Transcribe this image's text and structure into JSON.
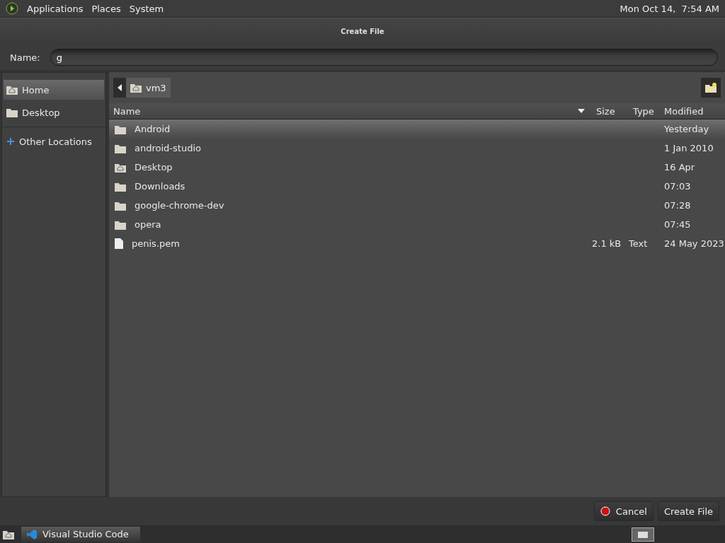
{
  "top_panel": {
    "menus": [
      "Applications",
      "Places",
      "System"
    ],
    "clock": "Mon Oct 14,  7:54 AM"
  },
  "window": {
    "title": "Create File"
  },
  "name_field": {
    "label": "Name:",
    "value": "g"
  },
  "sidebar": {
    "items": [
      {
        "label": "Home",
        "kind": "home",
        "selected": true
      },
      {
        "label": "Desktop",
        "kind": "folder",
        "selected": false
      },
      {
        "label": "Other Locations",
        "kind": "plus",
        "selected": false
      }
    ]
  },
  "path_bar": {
    "segments": [
      {
        "label": "vm3",
        "selected": true
      }
    ]
  },
  "table": {
    "columns": [
      "Name",
      "Size",
      "Type",
      "Modified"
    ],
    "rows": [
      {
        "name": "Android",
        "kind": "folder",
        "size": "",
        "type": "",
        "modified": "Yesterday",
        "selected": true
      },
      {
        "name": "android-studio",
        "kind": "folder",
        "modified": "1 Jan 2010",
        "selected": false
      },
      {
        "name": "Desktop",
        "kind": "home",
        "modified": "16 Apr",
        "selected": false
      },
      {
        "name": "Downloads",
        "kind": "folder",
        "modified": "07:03",
        "selected": false
      },
      {
        "name": "google-chrome-dev",
        "kind": "folder",
        "modified": "07:28",
        "selected": false
      },
      {
        "name": "opera",
        "kind": "folder",
        "modified": "07:45",
        "selected": false
      },
      {
        "name": "penis.pem",
        "kind": "file",
        "size": "2.1 kB",
        "type": "Text",
        "modified": "24 May 2023",
        "selected": false
      }
    ]
  },
  "buttons": [
    {
      "label": "Cancel",
      "kind": "cancel"
    },
    {
      "label": "Create File",
      "kind": "default"
    }
  ],
  "taskbar": {
    "tasks": [
      {
        "label": "Visual Studio Code",
        "selected": true
      }
    ]
  }
}
